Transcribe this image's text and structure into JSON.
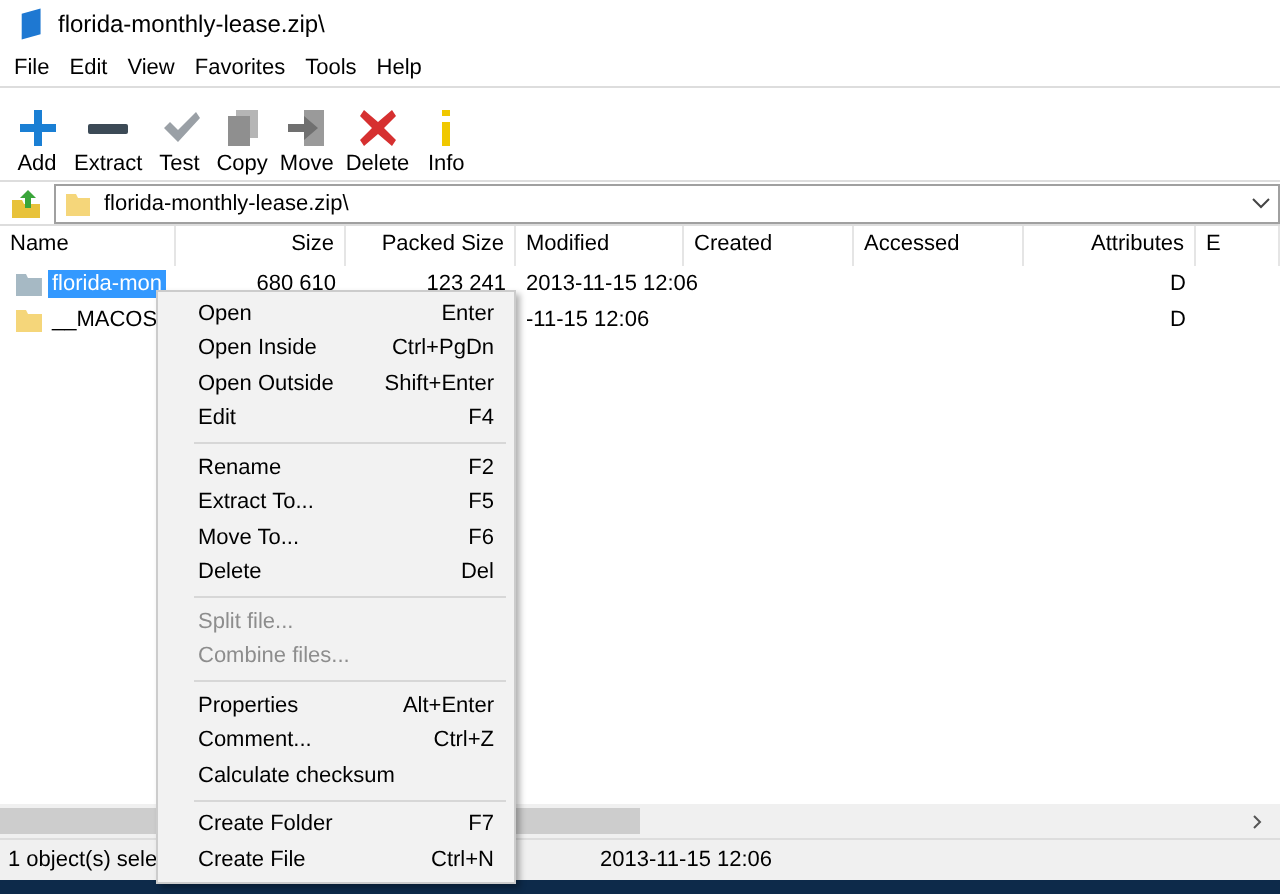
{
  "window": {
    "title": "florida-monthly-lease.zip\\"
  },
  "menu_bar": [
    "File",
    "Edit",
    "View",
    "Favorites",
    "Tools",
    "Help"
  ],
  "toolbar": [
    {
      "kind": "add",
      "label": "Add"
    },
    {
      "kind": "extract",
      "label": "Extract"
    },
    {
      "kind": "test",
      "label": "Test"
    },
    {
      "kind": "copy",
      "label": "Copy"
    },
    {
      "kind": "move",
      "label": "Move"
    },
    {
      "kind": "delete",
      "label": "Delete"
    },
    {
      "kind": "info",
      "label": "Info"
    }
  ],
  "address": {
    "value": "florida-monthly-lease.zip\\"
  },
  "table": {
    "columns": [
      "Name",
      "Size",
      "Packed Size",
      "Modified",
      "Created",
      "Accessed",
      "Attributes",
      "E"
    ],
    "rows": [
      {
        "name": "florida-mon",
        "size": "680 610",
        "packed_size": "123 241",
        "modified": "2013-11-15 12:06",
        "attributes": "D",
        "selected": true
      },
      {
        "name": "__MACOS",
        "modified": "-11-15 12:06",
        "attributes": "D",
        "selected": false
      }
    ]
  },
  "context_menu": [
    {
      "kind": "item",
      "label": "Open",
      "shortcut": "Enter",
      "disabled": false
    },
    {
      "kind": "item",
      "label": "Open Inside",
      "shortcut": "Ctrl+PgDn",
      "disabled": false
    },
    {
      "kind": "item",
      "label": "Open Outside",
      "shortcut": "Shift+Enter",
      "disabled": false
    },
    {
      "kind": "item",
      "label": "Edit",
      "shortcut": "F4",
      "disabled": false
    },
    {
      "kind": "separator"
    },
    {
      "kind": "item",
      "label": "Rename",
      "shortcut": "F2",
      "disabled": false
    },
    {
      "kind": "item",
      "label": "Extract To...",
      "shortcut": "F5",
      "disabled": false
    },
    {
      "kind": "item",
      "label": "Move To...",
      "shortcut": "F6",
      "disabled": false
    },
    {
      "kind": "item",
      "label": "Delete",
      "shortcut": "Del",
      "disabled": false
    },
    {
      "kind": "separator"
    },
    {
      "kind": "item",
      "label": "Split file...",
      "disabled": true
    },
    {
      "kind": "item",
      "label": "Combine files...",
      "disabled": true
    },
    {
      "kind": "separator"
    },
    {
      "kind": "item",
      "label": "Properties",
      "shortcut": "Alt+Enter",
      "disabled": false
    },
    {
      "kind": "item",
      "label": "Comment...",
      "shortcut": "Ctrl+Z",
      "disabled": false
    },
    {
      "kind": "item",
      "label": "Calculate checksum",
      "disabled": false
    },
    {
      "kind": "separator"
    },
    {
      "kind": "item",
      "label": "Create Folder",
      "shortcut": "F7",
      "disabled": false
    },
    {
      "kind": "item",
      "label": "Create File",
      "shortcut": "Ctrl+N",
      "disabled": false
    }
  ],
  "status_bar": [
    "1 object(s) sele",
    "2013-11-15 12:06"
  ]
}
